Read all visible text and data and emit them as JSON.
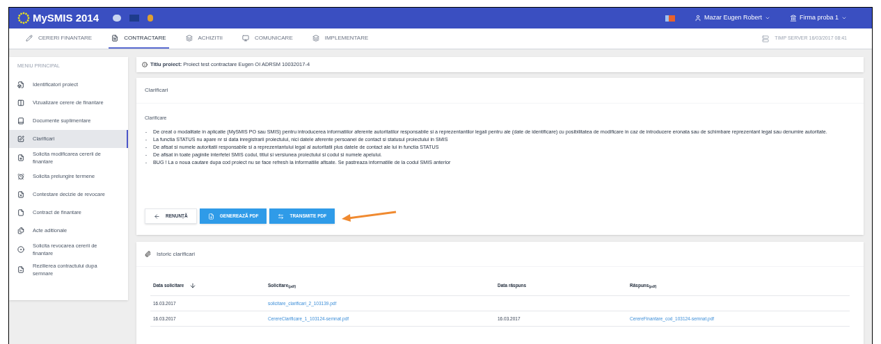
{
  "window": {
    "title": "MySMIS 2014"
  },
  "header": {
    "user": "Mazar Eugen Robert",
    "company": "Firma proba 1"
  },
  "tabs": [
    {
      "label": "CERERI FINANTARE",
      "selected": false
    },
    {
      "label": "CONTRACTARE",
      "selected": true
    },
    {
      "label": "ACHIZITII",
      "selected": false
    },
    {
      "label": "COMUNICARE",
      "selected": false
    },
    {
      "label": "IMPLEMENTARE",
      "selected": false
    }
  ],
  "server_time": "TIMP SERVER 16/03/2017 08:41",
  "sidebar": {
    "title": "MENIU PRINCIPAL",
    "items": [
      {
        "label": "Identificatori proiect",
        "selected": false
      },
      {
        "label": "Vizualizare cerere de finantare",
        "selected": false
      },
      {
        "label": "Documente suplimentare",
        "selected": false
      },
      {
        "label": "Clarificari",
        "selected": true
      },
      {
        "label": "Solicita modificarea cererii de finantare",
        "selected": false
      },
      {
        "label": "Solicita prelungire termene",
        "selected": false
      },
      {
        "label": "Contestare decizie de revocare",
        "selected": false
      },
      {
        "label": "Contract de finantare",
        "selected": false
      },
      {
        "label": "Acte aditionale",
        "selected": false
      },
      {
        "label": "Solicita revocarea cererii de finantare",
        "selected": false
      },
      {
        "label": "Rezilierea contractului dupa semnare",
        "selected": false
      }
    ]
  },
  "project_title": "**Titlu proiect:** Proiect test contractare Eugen OI ADRSM 10032017-4",
  "clarification": {
    "title": "Clarificari",
    "label": "Clarificare",
    "lines": [
      {
        "marker": "-",
        "text": "De creat o modalitate in aplicatie (MySMIS PO sau SMIS) pentru introducerea informatiilor aferente autoritatilor responsabile si a reprezentantilor legali pentru ale (date de identificare) cu posibilitatea de modificare in caz de introducere eronata sau de schimbare reprezentant legal sau denumire autoritate."
      },
      {
        "marker": "-",
        "text": "La functia STATUS nu apare nr si data inregistrarii proiectului, nici datele aferente persoanei de contact si statusul proiectului in SMIS"
      },
      {
        "marker": "-",
        "text": "De afisat si numele autoritatii responsabile si a reprezentantului legal al autoritatii plus datele de contact ale lui in functia STATUS"
      },
      {
        "marker": "-",
        "text": "De afisat in toate paginile interfetei SMIS codul, titlul si versiunea proiectului si codul si numele apelului."
      },
      {
        "marker": "-",
        "text": "BUG ! La o noua cautare dupa cod proiect nu se face refresh la informatiile afisate. Se pastreaza informatiile de la codul SMIS anterior"
      }
    ],
    "buttons": [
      {
        "label": "RENUNȚĂ",
        "kind": "back"
      },
      {
        "label": "GENEREAZĂ PDF",
        "kind": "generate"
      },
      {
        "label": "TRANSMITE PDF",
        "kind": "send"
      }
    ]
  },
  "history": {
    "title": "Istoric clarificari",
    "columns": [
      "Data solicitare",
      "Solicitare$_{(pdf)}$",
      "Data răspuns",
      "Răspuns$_{(pdf)}$"
    ],
    "rows": [
      {
        "request_date": "16.03.2017",
        "request_file": "solicitare_clarificari_2_103139.pdf"
      },
      {
        "request_date": "16.03.2017",
        "request_file": "CerereClarificare_1_103124-semnat.pdf",
        "response_date": "16.03.2017",
        "response_file": "CerereFinantare_cod_103124-semnat.pdf"
      }
    ]
  }
}
